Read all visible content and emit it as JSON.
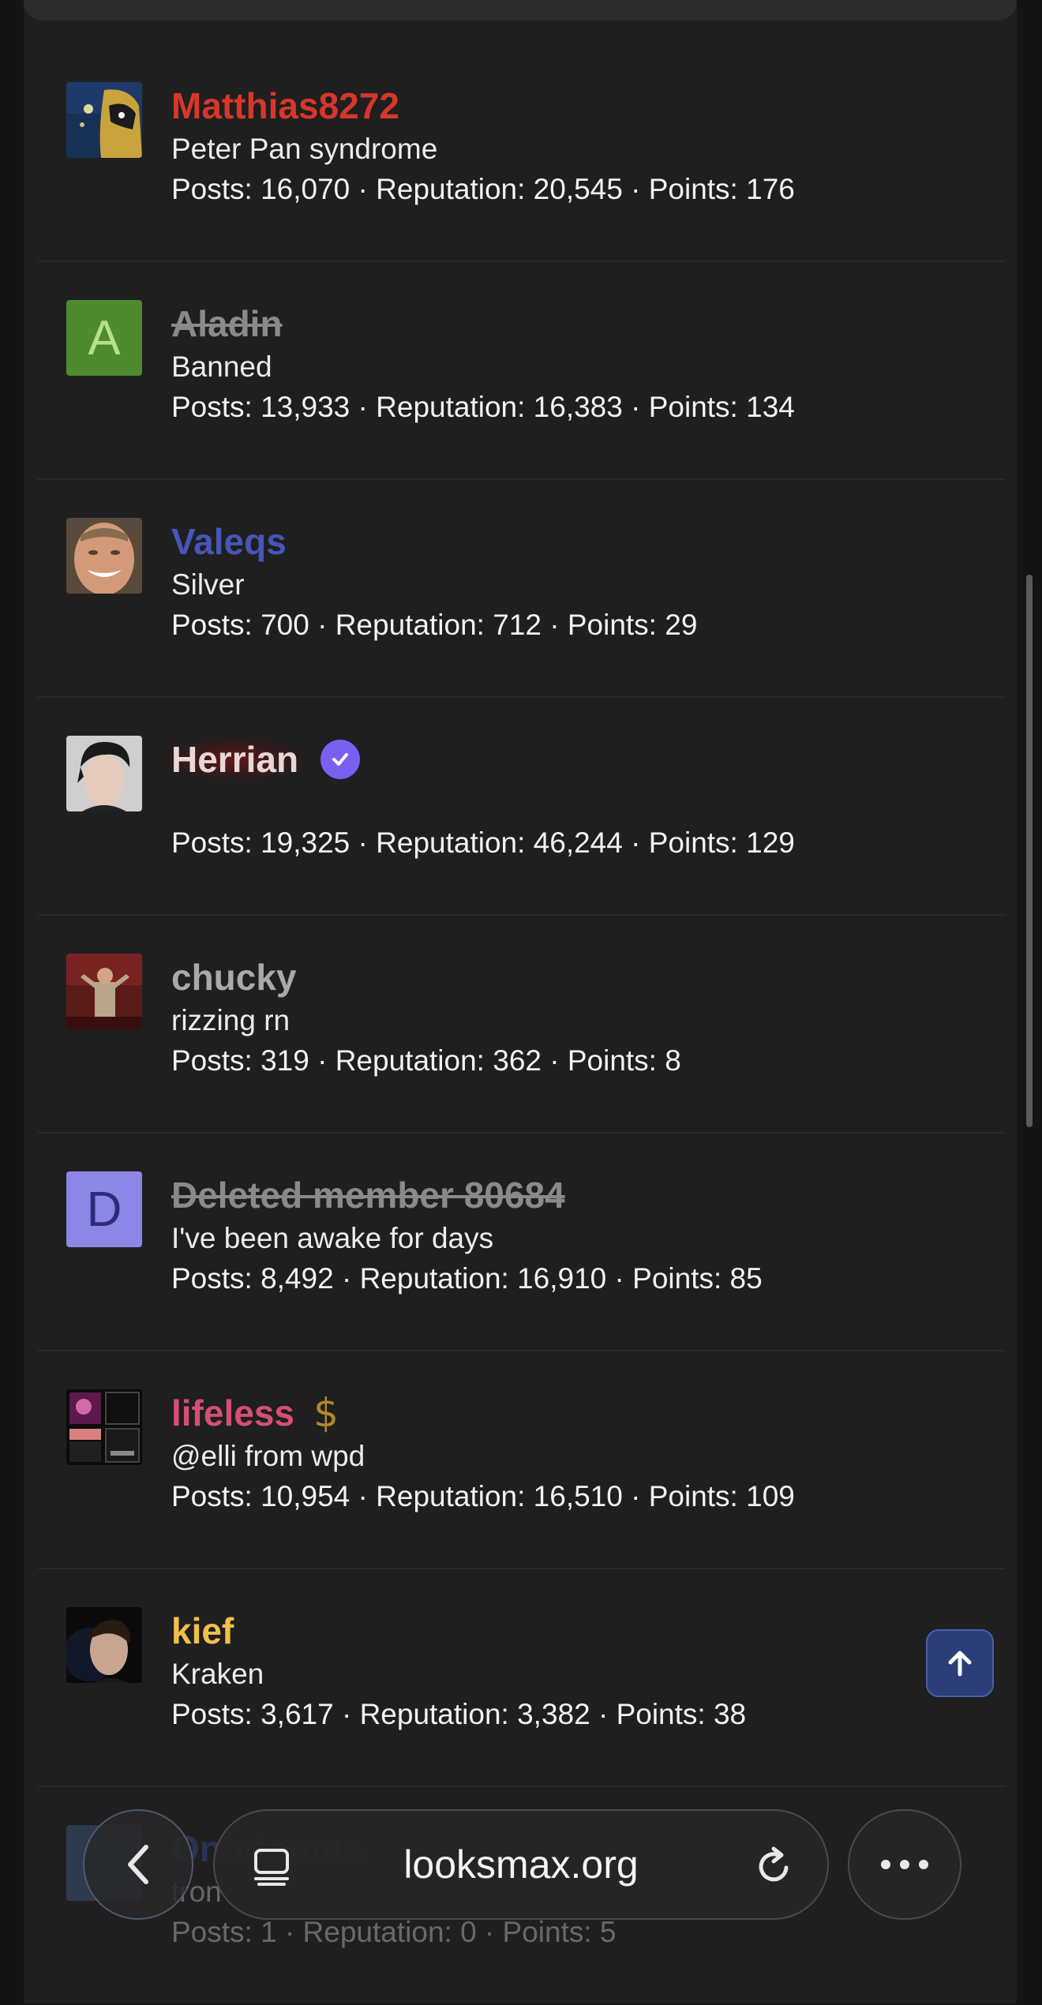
{
  "members": [
    {
      "name": "Matthias8272",
      "name_color": "#d6372a",
      "title": "Peter Pan syndrome",
      "stats": "Posts: 16,070 · Reputation: 20,545 · Points: 176"
    },
    {
      "name": "Aladin",
      "name_color": "#8a8a8a",
      "title": "Banned",
      "stats": "Posts: 13,933 · Reputation: 16,383 · Points: 134",
      "avatar_letter": "A",
      "avatar_color": "#4e8a2e",
      "avatar_letter_color": "#b6e08a"
    },
    {
      "name": "Valeqs",
      "name_color": "#4656b8",
      "title": "Silver",
      "stats": "Posts: 700 · Reputation: 712 · Points: 29"
    },
    {
      "name": "Herrian",
      "name_color": "#e9d6d6",
      "title": "",
      "stats": "Posts: 19,325 · Reputation: 46,244 · Points: 129"
    },
    {
      "name": "chucky",
      "name_color": "#a9a9a9",
      "title": "rizzing rn",
      "stats": "Posts: 319 · Reputation: 362 · Points: 8"
    },
    {
      "name": "Deleted member 80684",
      "name_color": "#8a8a8a",
      "title": "I've been awake for days",
      "stats": "Posts: 8,492 · Reputation: 16,910 · Points: 85",
      "avatar_letter": "D",
      "avatar_color": "#8c86e6",
      "avatar_letter_color": "#2d2a7a"
    },
    {
      "name": "lifeless",
      "name_color": "#d64f73",
      "title": "@elli from wpd",
      "stats": "Posts: 10,954 · Reputation: 16,510 · Points: 109"
    },
    {
      "name": "kief",
      "name_color": "#f0c04a",
      "title": "Kraken",
      "stats": "Posts: 3,617 · Reputation: 3,382 · Points: 38"
    },
    {
      "name": "Onbdomus",
      "name_color": "#4656b8",
      "title": "tron",
      "stats": "Posts: 1 · Reputation: 0 · Points: 5"
    }
  ],
  "browser": {
    "url": "looksmax.org"
  },
  "icons": {
    "check": "verified-check-icon",
    "dollar": "dollar-badge-icon",
    "up": "arrow-up-icon",
    "back": "chevron-left-icon",
    "tabs": "tabs-icon",
    "reload": "reload-icon",
    "more": "more-dots-icon"
  }
}
